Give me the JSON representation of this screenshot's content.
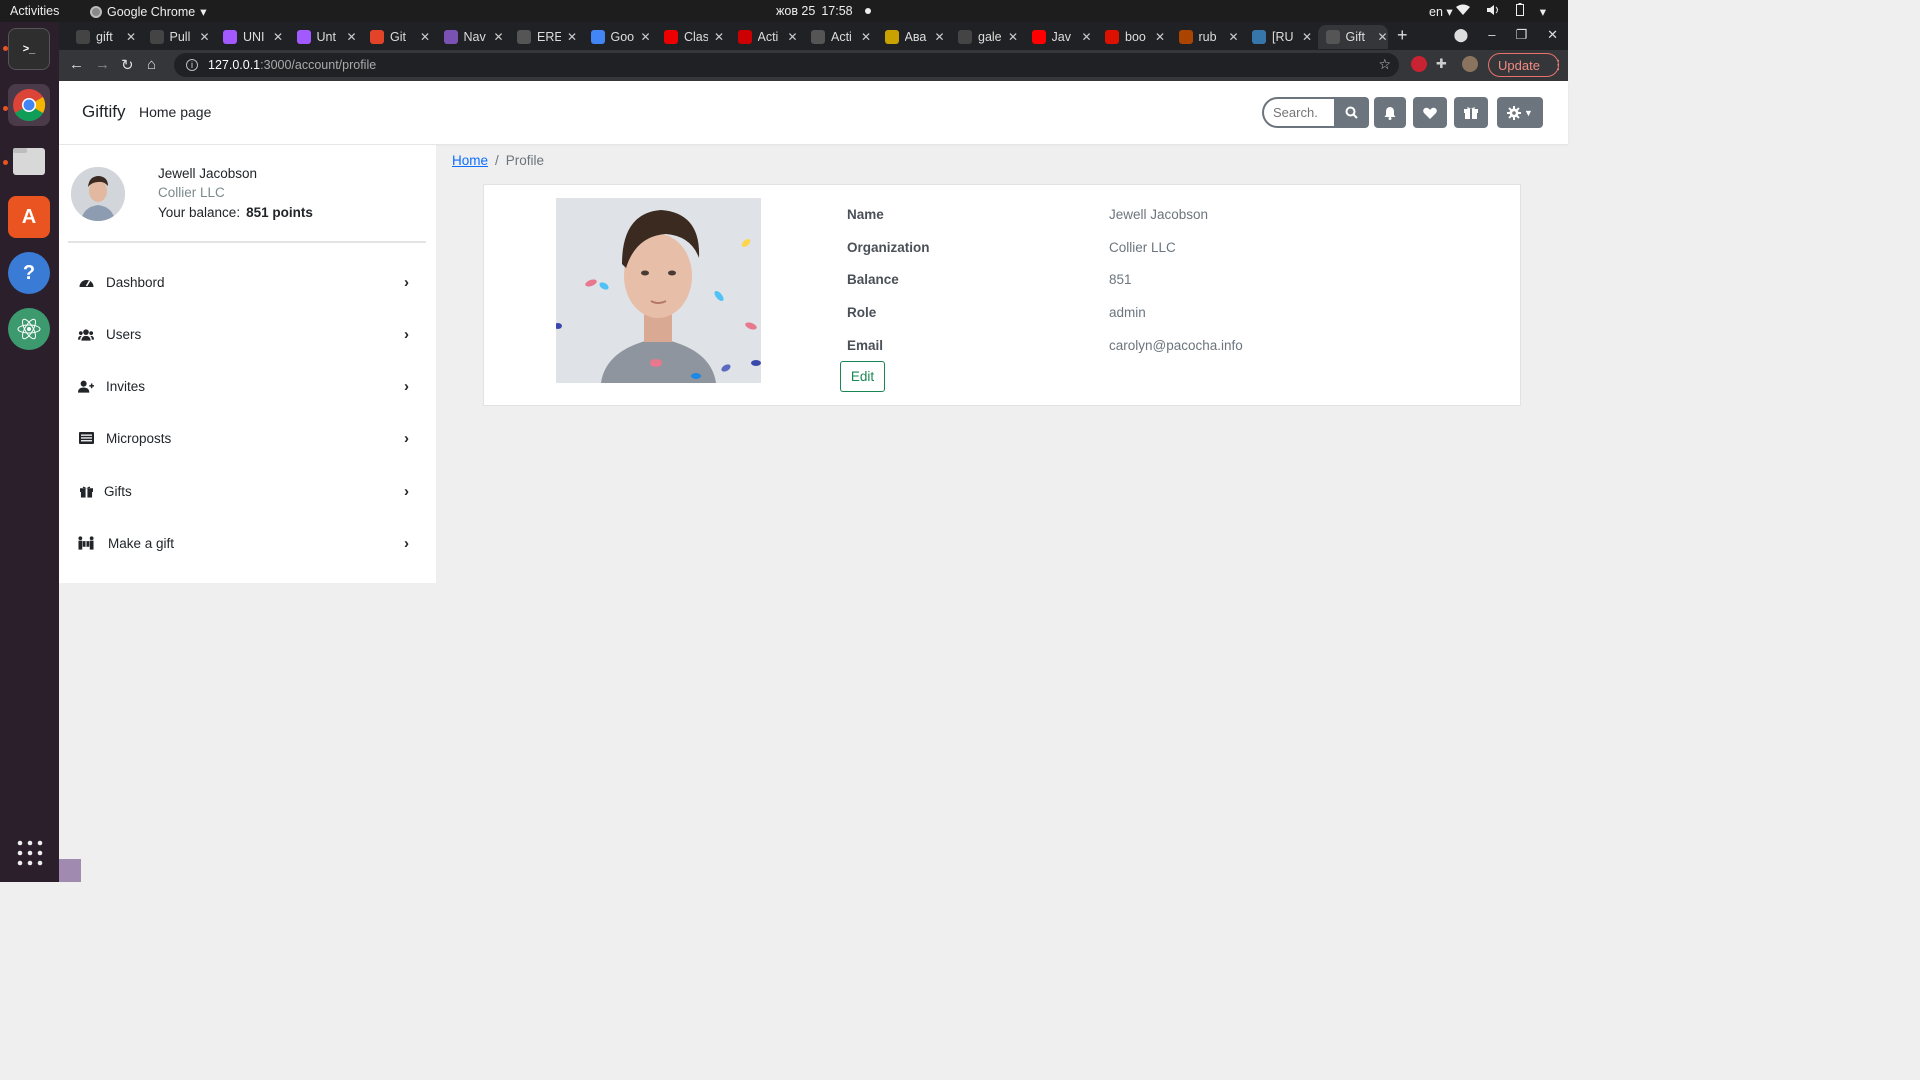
{
  "system": {
    "activities": "Activities",
    "app_name": "Google Chrome",
    "clock_date": "жов 25",
    "clock_time": "17:58",
    "lang": "en"
  },
  "tabs": [
    {
      "label": "gift",
      "color": "#444"
    },
    {
      "label": "Pull",
      "color": "#444"
    },
    {
      "label": "UNI",
      "color": "#a259ff"
    },
    {
      "label": "Unt",
      "color": "#a259ff"
    },
    {
      "label": "Git",
      "color": "#e24329"
    },
    {
      "label": "Nav",
      "color": "#7952b3"
    },
    {
      "label": "ERE",
      "color": "#555"
    },
    {
      "label": "Goo",
      "color": "#4285f4"
    },
    {
      "label": "Clas",
      "color": "#e00"
    },
    {
      "label": "Acti",
      "color": "#c00"
    },
    {
      "label": "Acti",
      "color": "#555"
    },
    {
      "label": "Ава",
      "color": "#c8a200"
    },
    {
      "label": "gale",
      "color": "#444"
    },
    {
      "label": "Jav",
      "color": "#f00"
    },
    {
      "label": "boo",
      "color": "#d10"
    },
    {
      "label": "rub",
      "color": "#a40"
    },
    {
      "label": "[RU",
      "color": "#3776ab"
    },
    {
      "label": "Gift",
      "color": "#555"
    }
  ],
  "address": {
    "host": "127.0.0.1",
    "path": ":3000/account/profile",
    "update_label": "Update"
  },
  "navbar": {
    "brand": "Giftify",
    "home_link": "Home page",
    "search_placeholder": "Search."
  },
  "sidebar": {
    "user_name": "Jewell Jacobson",
    "user_org": "Collier LLC",
    "balance_label": "Your balance:",
    "balance_value": "851 points",
    "items": [
      {
        "label": "Dashbord",
        "icon": "dashboard-icon"
      },
      {
        "label": "Users",
        "icon": "users-icon"
      },
      {
        "label": "Invites",
        "icon": "user-plus-icon"
      },
      {
        "label": "Microposts",
        "icon": "list-icon"
      },
      {
        "label": "Gifts",
        "icon": "gift-icon"
      },
      {
        "label": "Make a gift",
        "icon": "people-carry-icon"
      }
    ]
  },
  "breadcrumb": {
    "home": "Home",
    "separator": "/",
    "current": "Profile"
  },
  "profile": {
    "fields": [
      {
        "label": "Name",
        "value": "Jewell Jacobson"
      },
      {
        "label": "Organization",
        "value": "Collier LLC"
      },
      {
        "label": "Balance",
        "value": "851"
      },
      {
        "label": "Role",
        "value": "admin"
      },
      {
        "label": "Email",
        "value": "carolyn@pacocha.info"
      }
    ],
    "edit_label": "Edit"
  },
  "colors": {
    "dock": "#2b1f2c",
    "nav_button": "#6c757d",
    "edit_green": "#198754",
    "link_blue": "#0d6efd"
  }
}
